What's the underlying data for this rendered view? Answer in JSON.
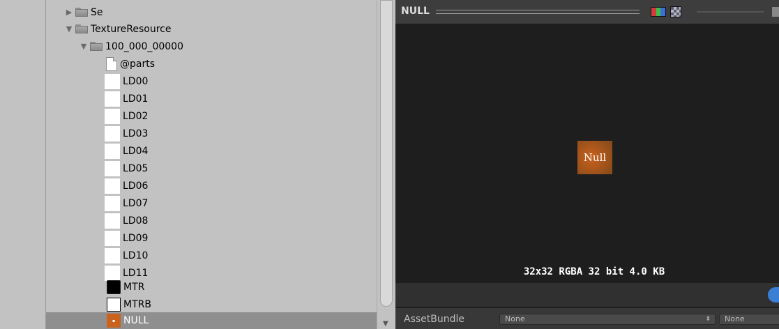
{
  "tree": {
    "items": [
      {
        "label": "Se",
        "type": "folder",
        "arrow": "▶"
      },
      {
        "label": "TextureResource",
        "type": "folder",
        "arrow": "▼"
      },
      {
        "label": "100_000_00000",
        "type": "folder",
        "arrow": "▼"
      },
      {
        "label": "@parts",
        "type": "doc"
      },
      {
        "label": "LD00",
        "type": "texture"
      },
      {
        "label": "LD01",
        "type": "texture"
      },
      {
        "label": "LD02",
        "type": "texture"
      },
      {
        "label": "LD03",
        "type": "texture"
      },
      {
        "label": "LD04",
        "type": "texture"
      },
      {
        "label": "LD05",
        "type": "texture"
      },
      {
        "label": "LD06",
        "type": "texture"
      },
      {
        "label": "LD07",
        "type": "texture"
      },
      {
        "label": "LD08",
        "type": "texture"
      },
      {
        "label": "LD09",
        "type": "texture"
      },
      {
        "label": "LD10",
        "type": "texture"
      },
      {
        "label": "LD11",
        "type": "texture"
      },
      {
        "label": "MTR",
        "type": "texture-black"
      },
      {
        "label": "MTRB",
        "type": "texture-outline"
      },
      {
        "label": "NULL",
        "type": "texture-null",
        "selected": true
      }
    ]
  },
  "preview": {
    "title": "NULL",
    "image_text": "Null",
    "info": "32x32  RGBA 32 bit  4.0 KB"
  },
  "asset_bundle": {
    "label": "AssetBundle",
    "name_value": "None",
    "variant_value": "None"
  },
  "colors": {
    "selection": "#8f8f8f",
    "null_texture": "#c9621d",
    "label_icon": "#3a7fd4"
  }
}
